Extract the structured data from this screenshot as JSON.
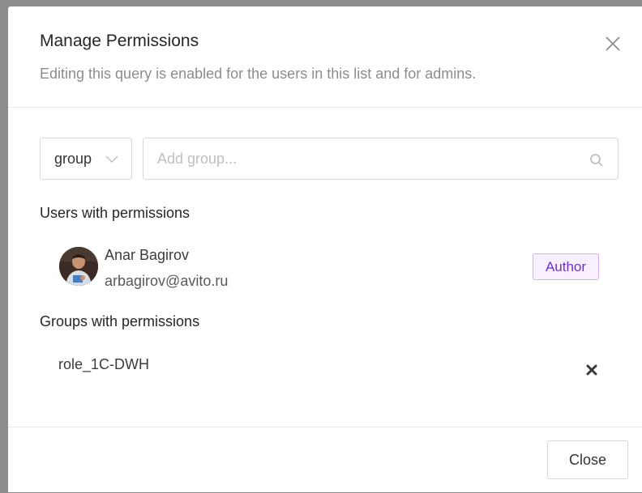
{
  "dialog": {
    "title": "Manage Permissions",
    "subtitle": "Editing this query is enabled for the users in this list and for admins."
  },
  "search": {
    "type_value": "group",
    "placeholder": "Add group..."
  },
  "users_section": {
    "heading": "Users with permissions",
    "users": [
      {
        "name": "Anar Bagirov",
        "email": "arbagirov@avito.ru",
        "badge": "Author"
      }
    ]
  },
  "groups_section": {
    "heading": "Groups with permissions",
    "groups": [
      {
        "name": "role_1C-DWH"
      }
    ]
  },
  "footer": {
    "close_label": "Close"
  },
  "icons": {
    "dialog_close": "close-icon",
    "select_chevron": "chevron-down-icon",
    "search": "search-icon",
    "remove_group": "remove-icon"
  },
  "colors": {
    "author_badge_text": "#722ed1",
    "author_badge_bg": "#f9f0ff",
    "author_badge_border": "#d3adf7"
  }
}
